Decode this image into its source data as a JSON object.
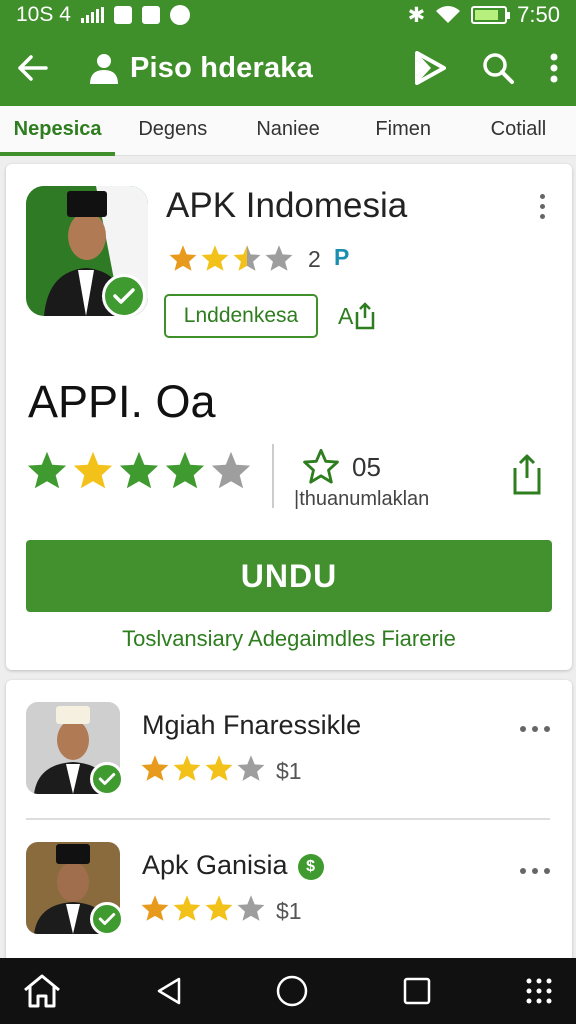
{
  "status_bar": {
    "left_text": "10S 4",
    "time": "7:50",
    "battery_level_percent": 80
  },
  "app_bar": {
    "title": "Piso hderaka",
    "icons": [
      "back-arrow-icon",
      "person-icon",
      "play-store-icon",
      "search-icon",
      "more-vert-icon"
    ],
    "color": "#3f8f2a"
  },
  "tabs": [
    {
      "label": "Nepesica",
      "active": true
    },
    {
      "label": "Degens",
      "active": false
    },
    {
      "label": "Naniee",
      "active": false
    },
    {
      "label": "Fimen",
      "active": false
    },
    {
      "label": "Cotiall",
      "active": false
    }
  ],
  "app_detail": {
    "name": "APK Indomesia",
    "rating_stars": 2.5,
    "rating_count": "2",
    "rating_badge": "P",
    "category_chip": "Lnddenkesa",
    "share_label": "A",
    "big_title": "APPI. Oa",
    "big_rating_stars": 4,
    "review_number": "05",
    "review_label": "|thuanumlaklan",
    "install_button": "UNDU",
    "footnote": "Toslvansiary Adegaimdles Fiarerie"
  },
  "list": [
    {
      "title": "Mgiah Fnaressikle",
      "stars": 3,
      "price": "$1",
      "badge": ""
    },
    {
      "title": "Apk Ganisia",
      "stars": 3,
      "price": "$1",
      "badge": "$"
    }
  ],
  "nav_bar": {
    "icons": [
      "home-icon",
      "back-triangle-icon",
      "home-circle-icon",
      "recents-square-icon",
      "apps-grid-icon"
    ]
  },
  "colors": {
    "primary": "#3f8f2a",
    "star_gold": "#f2c21a",
    "star_green": "#3f9b2f",
    "star_grey": "#9e9e9e"
  }
}
